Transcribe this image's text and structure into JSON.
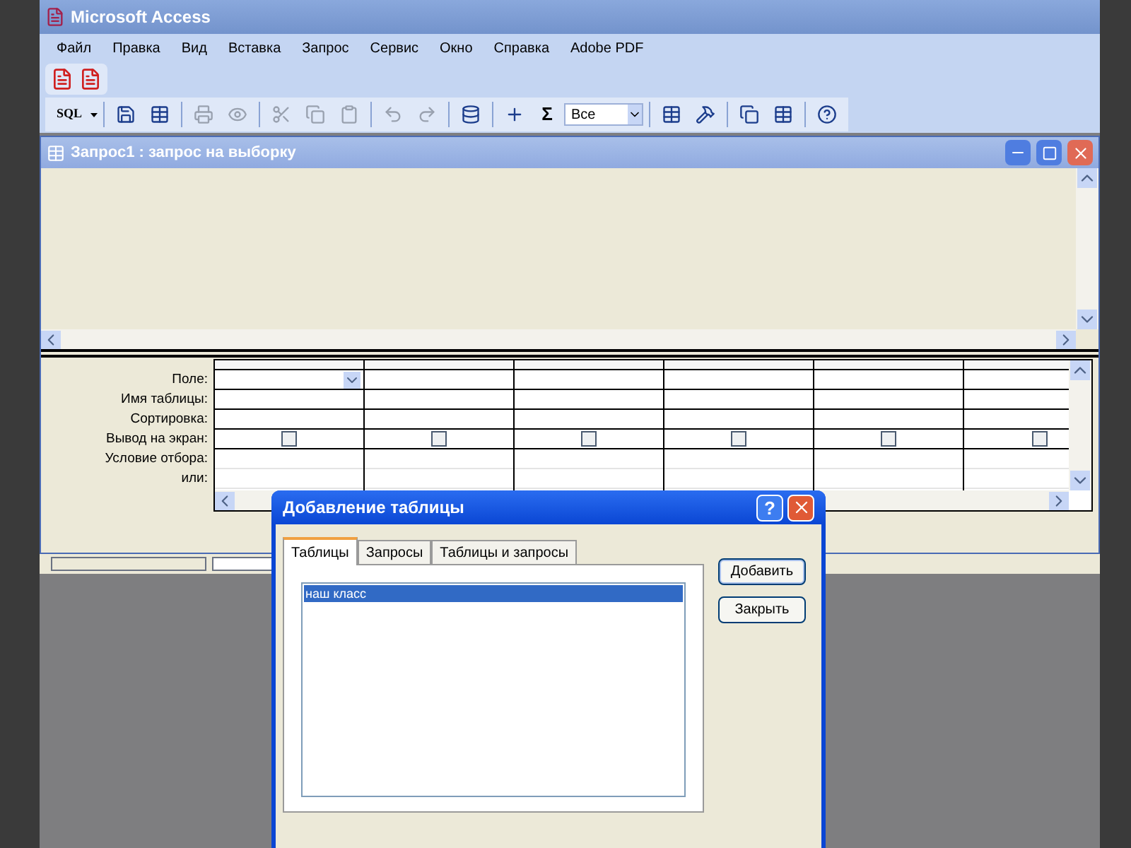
{
  "window": {
    "title": "Microsoft Access"
  },
  "menu": [
    "Файл",
    "Правка",
    "Вид",
    "Вставка",
    "Запрос",
    "Сервис",
    "Окно",
    "Справка",
    "Adobe PDF"
  ],
  "toolbar": {
    "sql_label": "SQL",
    "sum_label": "Σ",
    "top_values": "Все"
  },
  "query_window": {
    "title": "Запрос1 : запрос на выборку"
  },
  "grid": {
    "row_labels": [
      "Поле:",
      "Имя таблицы:",
      "Сортировка:",
      "Вывод на экран:",
      "Условие отбора:",
      "или:"
    ],
    "columns": [
      {
        "show_checked": false
      },
      {
        "show_checked": false
      },
      {
        "show_checked": false
      },
      {
        "show_checked": false
      },
      {
        "show_checked": false
      },
      {
        "show_checked": false
      }
    ]
  },
  "dialog": {
    "title": "Добавление таблицы",
    "help": "?",
    "tabs": [
      {
        "label": "Таблицы",
        "selected": true
      },
      {
        "label": "Запросы",
        "selected": false
      },
      {
        "label": "Таблицы и запросы",
        "selected": false
      }
    ],
    "items": [
      {
        "label": "наш класс",
        "selected": true
      }
    ],
    "buttons": [
      "Добавить",
      "Закрыть"
    ]
  }
}
